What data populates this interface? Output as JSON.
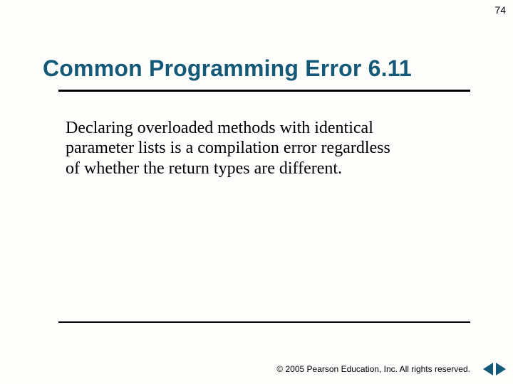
{
  "page_number": "74",
  "title": "Common Programming Error 6.11",
  "body": "Declaring overloaded methods with identical parameter lists is a compilation error regardless of whether the return types are different.",
  "footer": "© 2005 Pearson Education, Inc.  All rights reserved."
}
